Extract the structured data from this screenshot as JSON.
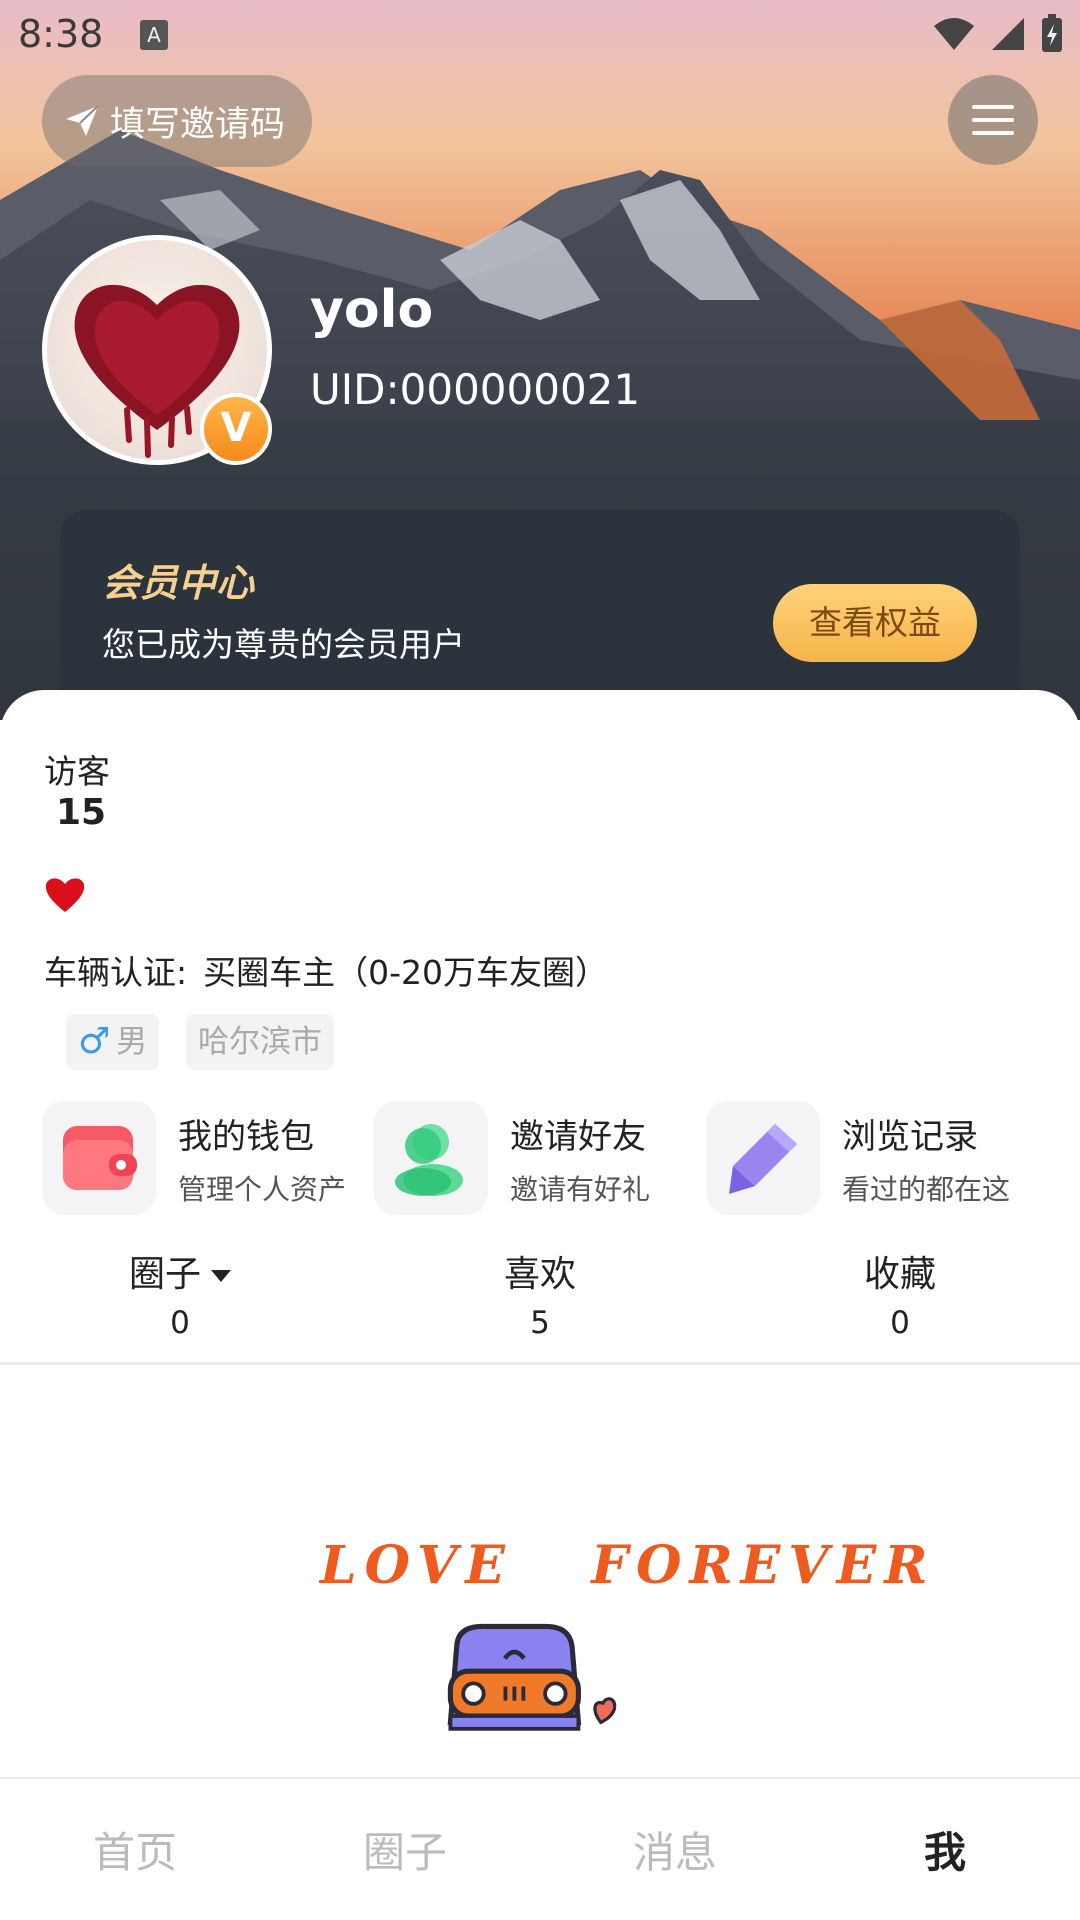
{
  "status_bar": {
    "time": "8:38",
    "notification_icon": "A",
    "icons": [
      "wifi-icon",
      "signal-icon",
      "battery-icon"
    ]
  },
  "header": {
    "invite_label": "填写邀请码",
    "username": "yolo",
    "uid": "UID:000000021",
    "vip_badge": "V"
  },
  "member": {
    "title": "会员中心",
    "subtitle": "您已成为尊贵的会员用户",
    "button": "查看权益"
  },
  "profile": {
    "visitor_label": "访客",
    "visitor_count": "15",
    "vehicle_label": "车辆认证:",
    "vehicle_value": "买圈车主（0-20万车友圈）",
    "gender_symbol": "♂",
    "gender": "男",
    "city": "哈尔滨市"
  },
  "shortcuts": [
    {
      "title": "我的钱包",
      "desc": "管理个人资产",
      "icon": "wallet-icon"
    },
    {
      "title": "邀请好友",
      "desc": "邀请有好礼",
      "icon": "friends-icon"
    },
    {
      "title": "浏览记录",
      "desc": "看过的都在这",
      "icon": "pencil-icon"
    }
  ],
  "stats": [
    {
      "name": "圈子",
      "value": "0"
    },
    {
      "name": "喜欢",
      "value": "5"
    },
    {
      "name": "收藏",
      "value": "0"
    }
  ],
  "illustration": {
    "text": "LOVE   FOREVER"
  },
  "nav": [
    {
      "label": "首页"
    },
    {
      "label": "圈子"
    },
    {
      "label": "消息"
    },
    {
      "label": "我"
    }
  ],
  "colors": {
    "accent_orange": "#f6b44a",
    "member_gold": "#f5d090",
    "gender_blue": "#3a9af0",
    "love_orange": "#ef5a1e"
  }
}
